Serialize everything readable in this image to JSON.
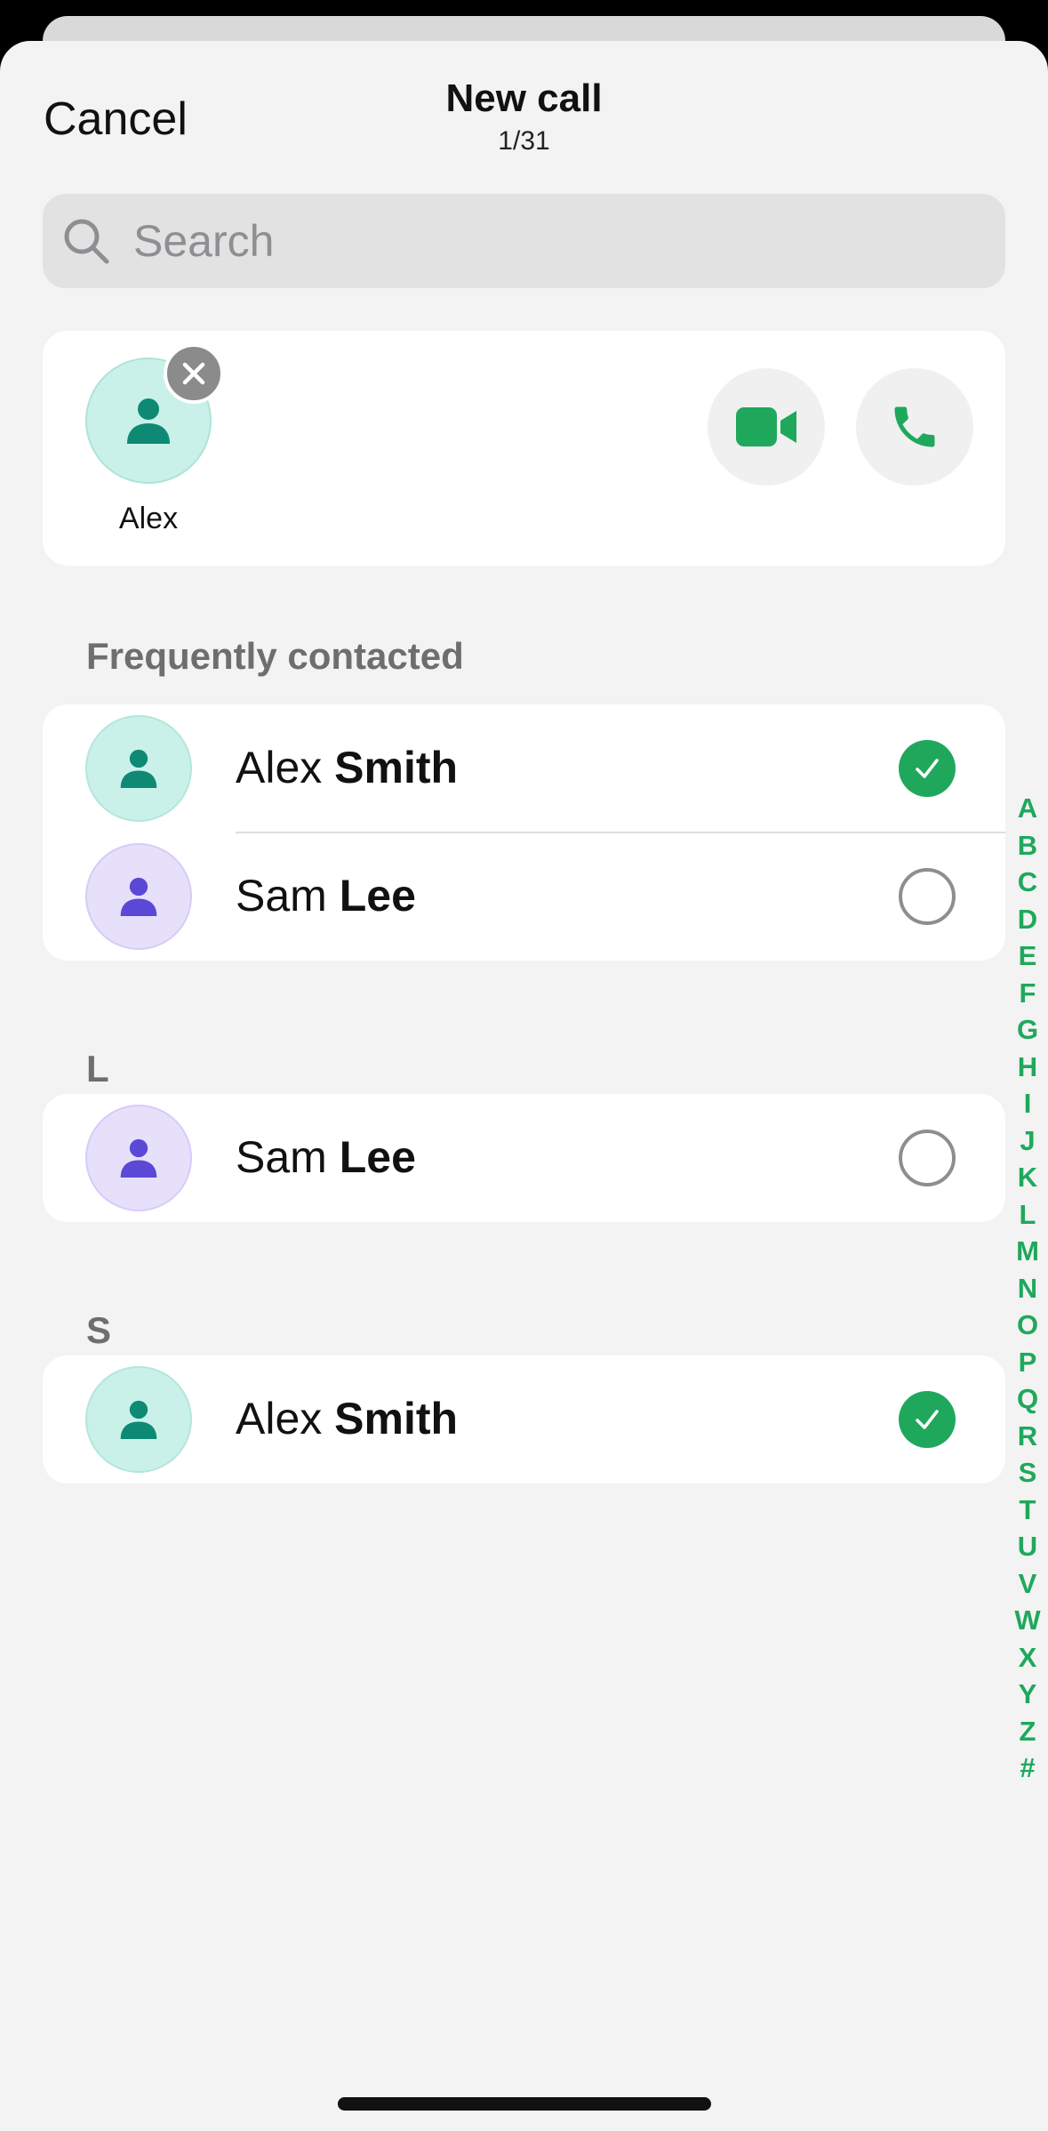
{
  "header": {
    "cancel_label": "Cancel",
    "title": "New call",
    "subtitle": "1/31"
  },
  "search": {
    "placeholder": "Search",
    "value": ""
  },
  "selected": {
    "name": "Alex",
    "actions": [
      "video-call",
      "voice-call"
    ]
  },
  "sections": [
    {
      "header": "Frequently contacted",
      "rows": [
        {
          "first": "Alex",
          "last": "Smith",
          "selected": true,
          "avatar": "teal"
        },
        {
          "first": "Sam",
          "last": "Lee",
          "selected": false,
          "avatar": "purple"
        }
      ]
    },
    {
      "header": "L",
      "rows": [
        {
          "first": "Sam",
          "last": "Lee",
          "selected": false,
          "avatar": "purple"
        }
      ]
    },
    {
      "header": "S",
      "rows": [
        {
          "first": "Alex",
          "last": "Smith",
          "selected": true,
          "avatar": "teal"
        }
      ]
    }
  ],
  "index_letters": [
    "A",
    "B",
    "C",
    "D",
    "E",
    "F",
    "G",
    "H",
    "I",
    "J",
    "K",
    "L",
    "M",
    "N",
    "O",
    "P",
    "Q",
    "R",
    "S",
    "T",
    "U",
    "V",
    "W",
    "X",
    "Y",
    "Z",
    "#"
  ],
  "colors": {
    "accent_green": "#1fa85c",
    "teal_avatar_bg": "#c9f1ea",
    "teal_avatar_icon": "#0e8a74",
    "purple_avatar_bg": "#e6e0fb",
    "purple_avatar_icon": "#5b48d6",
    "sheet_bg": "#f3f3f3"
  }
}
